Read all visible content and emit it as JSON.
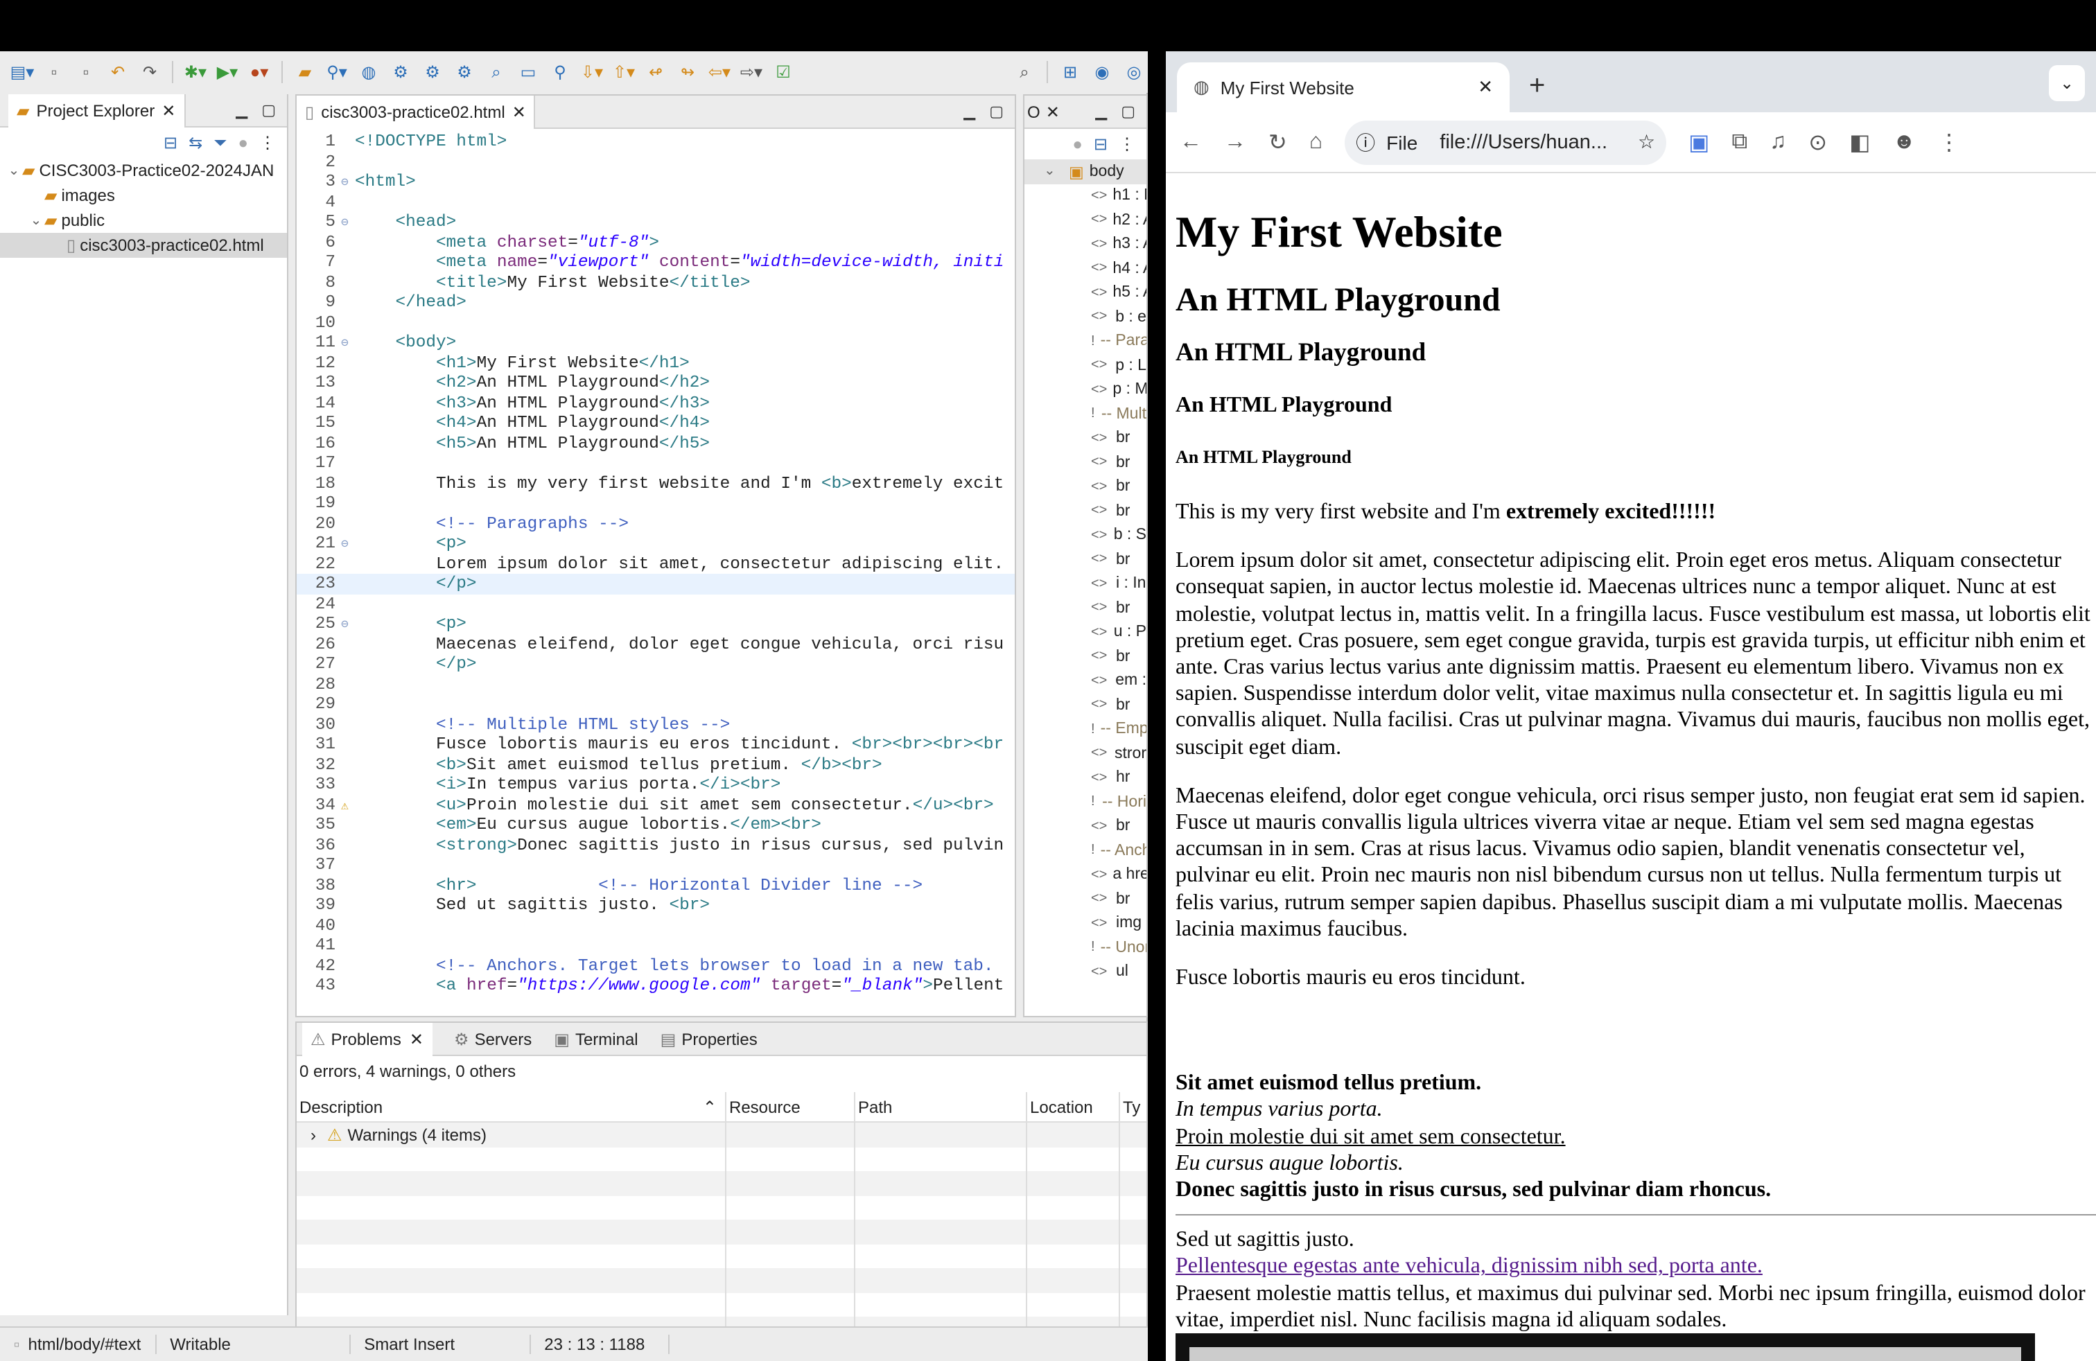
{
  "eclipse": {
    "project_explorer": {
      "title": "Project Explorer",
      "items": [
        {
          "label": "CISC3003-Practice02-2024JAN",
          "indent": 0
        },
        {
          "label": "images",
          "indent": 1
        },
        {
          "label": "public",
          "indent": 1
        },
        {
          "label": "cisc3003-practice02.html",
          "indent": 2
        }
      ]
    },
    "editor": {
      "tab": "cisc3003-practice02.html",
      "lines": [
        {
          "n": "1",
          "html": "<span class='tag'>&lt;!DOCTYPE html&gt;</span>"
        },
        {
          "n": "2",
          "html": ""
        },
        {
          "n": "3",
          "html": "<span class='tag'>&lt;html&gt;</span>"
        },
        {
          "n": "4",
          "html": ""
        },
        {
          "n": "5",
          "html": "    <span class='tag'>&lt;head&gt;</span>"
        },
        {
          "n": "6",
          "html": "        <span class='tag'>&lt;meta</span> <span class='attr'>charset</span>=<span class='val'>\"utf-8\"</span><span class='tag'>&gt;</span>"
        },
        {
          "n": "7",
          "html": "        <span class='tag'>&lt;meta</span> <span class='attr'>name</span>=<span class='val'>\"viewport\"</span> <span class='attr'>content</span>=<span class='val'>\"width=device-width, initi</span>"
        },
        {
          "n": "8",
          "html": "        <span class='tag'>&lt;title&gt;</span>My First Website<span class='tag'>&lt;/title&gt;</span>"
        },
        {
          "n": "9",
          "html": "    <span class='tag'>&lt;/head&gt;</span>"
        },
        {
          "n": "10",
          "html": ""
        },
        {
          "n": "11",
          "html": "    <span class='tag'>&lt;body&gt;</span>"
        },
        {
          "n": "12",
          "html": "        <span class='tag'>&lt;h1&gt;</span>My First Website<span class='tag'>&lt;/h1&gt;</span>"
        },
        {
          "n": "13",
          "html": "        <span class='tag'>&lt;h2&gt;</span>An HTML Playground<span class='tag'>&lt;/h2&gt;</span>"
        },
        {
          "n": "14",
          "html": "        <span class='tag'>&lt;h3&gt;</span>An HTML Playground<span class='tag'>&lt;/h3&gt;</span>"
        },
        {
          "n": "15",
          "html": "        <span class='tag'>&lt;h4&gt;</span>An HTML Playground<span class='tag'>&lt;/h4&gt;</span>"
        },
        {
          "n": "16",
          "html": "        <span class='tag'>&lt;h5&gt;</span>An HTML Playground<span class='tag'>&lt;/h5&gt;</span>"
        },
        {
          "n": "17",
          "html": ""
        },
        {
          "n": "18",
          "html": "        This is my very first website and I'm <span class='tag'>&lt;b&gt;</span>extremely excit"
        },
        {
          "n": "19",
          "html": ""
        },
        {
          "n": "20",
          "html": "        <span class='cmt'>&lt;!-- Paragraphs --&gt;</span>"
        },
        {
          "n": "21",
          "html": "        <span class='tag'>&lt;p&gt;</span>"
        },
        {
          "n": "22",
          "html": "        Lorem ipsum dolor sit amet, consectetur adipiscing elit."
        },
        {
          "n": "23",
          "html": "        <span class='tag'>&lt;/p&gt;</span>",
          "cur": true
        },
        {
          "n": "24",
          "html": ""
        },
        {
          "n": "25",
          "html": "        <span class='tag'>&lt;p&gt;</span>"
        },
        {
          "n": "26",
          "html": "        Maecenas eleifend, dolor eget congue vehicula, orci risu"
        },
        {
          "n": "27",
          "html": "        <span class='tag'>&lt;/p&gt;</span>"
        },
        {
          "n": "28",
          "html": ""
        },
        {
          "n": "29",
          "html": ""
        },
        {
          "n": "30",
          "html": "        <span class='cmt'>&lt;!-- Multiple HTML styles --&gt;</span>"
        },
        {
          "n": "31",
          "html": "        Fusce lobortis mauris eu eros tincidunt. <span class='tag'>&lt;br&gt;&lt;br&gt;&lt;br&gt;&lt;br</span>"
        },
        {
          "n": "32",
          "html": "        <span class='tag'>&lt;b&gt;</span>Sit amet euismod tellus pretium. <span class='tag'>&lt;/b&gt;&lt;br&gt;</span>"
        },
        {
          "n": "33",
          "html": "        <span class='tag'>&lt;i&gt;</span>In tempus varius porta.<span class='tag'>&lt;/i&gt;&lt;br&gt;</span>"
        },
        {
          "n": "34",
          "html": "        <span class='tag'>&lt;u&gt;</span>Proin molestie dui sit amet sem consectetur.<span class='tag'>&lt;/u&gt;&lt;br&gt;</span>"
        },
        {
          "n": "35",
          "html": "        <span class='tag'>&lt;em&gt;</span>Eu cursus augue lobortis.<span class='tag'>&lt;/em&gt;&lt;br&gt;</span>"
        },
        {
          "n": "36",
          "html": "        <span class='tag'>&lt;strong&gt;</span>Donec sagittis justo in risus cursus, sed pulvin"
        },
        {
          "n": "37",
          "html": ""
        },
        {
          "n": "38",
          "html": "        <span class='tag'>&lt;hr&gt;</span>            <span class='cmt'>&lt;!-- Horizontal Divider line --&gt;</span>"
        },
        {
          "n": "39",
          "html": "        Sed ut sagittis justo. <span class='tag'>&lt;br&gt;</span>"
        },
        {
          "n": "40",
          "html": ""
        },
        {
          "n": "41",
          "html": ""
        },
        {
          "n": "42",
          "html": "        <span class='cmt'>&lt;!-- Anchors. Target lets browser to load in a new tab.</span>"
        },
        {
          "n": "43",
          "html": "        <span class='tag'>&lt;a</span> <span class='attr'>href</span>=<span class='val'>\"https://www.google.com\"</span> <span class='attr'>target</span>=<span class='val'>\"_blank\"</span><span class='tag'>&gt;</span>Pellent"
        }
      ]
    },
    "outline": {
      "root": "body",
      "items": [
        "h1 : M",
        "h2 : A",
        "h3 : A",
        "h4 : A",
        "h5 : A",
        "b : e",
        "-- Para",
        "p : L",
        "p : M",
        "-- Mult",
        "br",
        "br",
        "br",
        "br",
        "b : S",
        "br",
        "i : In",
        "br",
        "u : P",
        "br",
        "em :",
        "br",
        "-- Emp",
        "stror",
        "hr",
        "-- Hori",
        "br",
        "-- Anch",
        "a hre",
        "br",
        "img",
        "-- Unor",
        "ul"
      ]
    },
    "problems": {
      "tabs": [
        "Problems",
        "Servers",
        "Terminal",
        "Properties"
      ],
      "summary": "0 errors, 4 warnings, 0 others",
      "columns": [
        "Description",
        "Resource",
        "Path",
        "Location",
        "Ty"
      ],
      "rows": [
        "Warnings (4 items)"
      ]
    },
    "status": {
      "path": "html/body/#text",
      "mode": "Writable",
      "insert": "Smart Insert",
      "pos": "23 : 13 : 1188"
    }
  },
  "chrome": {
    "tab_title": "My First Website",
    "address_scheme": "File",
    "address_url": "file:///Users/huan...",
    "page": {
      "h1": "My First Website",
      "h2": "An HTML Playground",
      "h3": "An HTML Playground",
      "h4": "An HTML Playground",
      "h5": "An HTML Playground",
      "intro_plain": "This is my very first website and I'm ",
      "intro_bold": "extremely excited!!!!!!",
      "p1": "Lorem ipsum dolor sit amet, consectetur adipiscing elit. Proin eget eros metus. Aliquam consectetur consequat sapien, in auctor lectus molestie id. Maecenas ultrices nunc a tempor aliquet. Nunc at est molestie, volutpat lectus in, mattis velit. In a fringilla lacus. Fusce vestibulum est massa, ut lobortis elit pretium eget. Cras posuere, sem eget congue gravida, turpis est gravida turpis, ut efficitur nibh enim et ante. Cras varius lectus varius ante dignissim mattis. Praesent eu elementum libero. Vivamus non ex sapien. Suspendisse interdum dolor velit, vitae maximus nulla consectetur et. In sagittis ligula eu mi convallis aliquet. Nulla facilisi. Cras ut pulvinar magna. Vivamus dui mauris, faucibus non mollis eget, suscipit eget diam.",
      "p2": "Maecenas eleifend, dolor eget congue vehicula, orci risus semper justo, non feugiat erat sem id sapien. Fusce ut mauris convallis ligula ultrices viverra vitae ar neque. Etiam vel sem sed magna egestas accumsan in in sem. Cras at risus lacus. Vivamus odio sapien, blandit venenatis consectetur vel, pulvinar eu elit. Proin nec mauris non nisl bibendum cursus non ut tellus. Nulla fermentum turpis ut felis varius, rutrum semper sapien dapibus. Phasellus suscipit diam a mi vulputate mollis. Maecenas lacinia maximus faucibus.",
      "fusce": "Fusce lobortis mauris eu eros tincidunt.",
      "bold": "Sit amet euismod tellus pretium.",
      "italic": "In tempus varius porta.",
      "underline": "Proin molestie dui sit amet sem consectetur.",
      "em": "Eu cursus augue lobortis.",
      "strong": "Donec sagittis justo in risus cursus, sed pulvinar diam rhoncus.",
      "sed": "Sed ut sagittis justo.",
      "link": "Pellentesque egestas ante vehicula, dignissim nibh sed, porta ante.",
      "after": "Praesent molestie mattis tellus, et maximus dui pulvinar sed. Morbi nec ipsum fringilla, euismod dolor vitae, imperdiet nisl. Nunc facilisis magna id aliquam sodales."
    }
  }
}
